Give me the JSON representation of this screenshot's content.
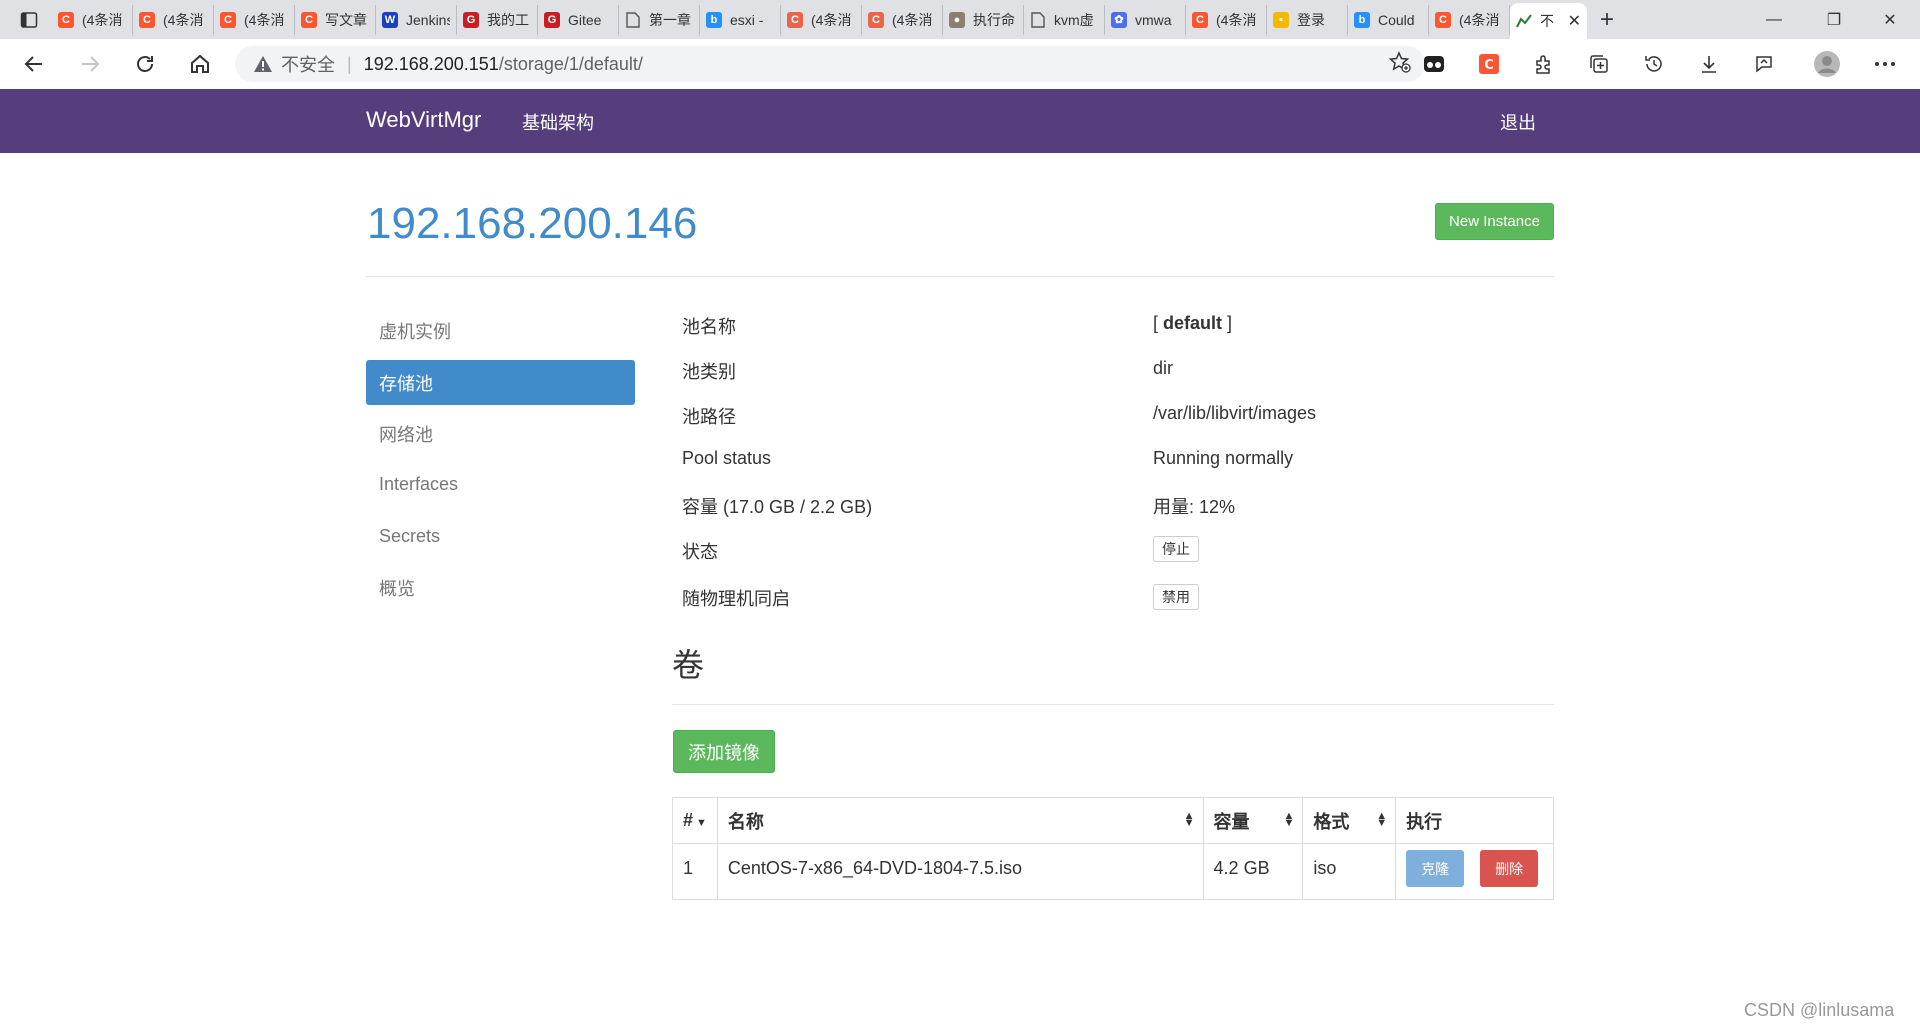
{
  "browser": {
    "tabs": [
      {
        "label": "(4条消",
        "icon": "csdn-icon",
        "color": "#fc5531"
      },
      {
        "label": "(4条消",
        "icon": "csdn-icon",
        "color": "#fc5531"
      },
      {
        "label": "(4条消",
        "icon": "csdn-icon",
        "color": "#fc5531"
      },
      {
        "label": "写文章",
        "icon": "csdn-icon",
        "color": "#fc5531"
      },
      {
        "label": "Jenkins",
        "icon": "w-icon",
        "color": "#1a3fc2"
      },
      {
        "label": "我的工",
        "icon": "gitee-icon",
        "color": "#c71d23"
      },
      {
        "label": "Gitee",
        "icon": "gitee-icon",
        "color": "#c71d23"
      },
      {
        "label": "第一章",
        "icon": "doc-icon",
        "color": "#555555"
      },
      {
        "label": "esxi -",
        "icon": "bing-icon",
        "color": "#258ffa"
      },
      {
        "label": "(4条消",
        "icon": "csdn-icon",
        "color": "#e8644a"
      },
      {
        "label": "(4条消",
        "icon": "csdn-icon",
        "color": "#e8644a"
      },
      {
        "label": "执行命",
        "icon": "avatar-icon",
        "color": "#8a7f70"
      },
      {
        "label": "kvm虚",
        "icon": "doc-icon",
        "color": "#555555"
      },
      {
        "label": "vmwa",
        "icon": "paw-icon",
        "color": "#4e6ef2"
      },
      {
        "label": "(4条消",
        "icon": "csdn-icon",
        "color": "#fc5531"
      },
      {
        "label": "登录",
        "icon": "tile-icon",
        "color": "#f5b800"
      },
      {
        "label": "Could",
        "icon": "bing-icon",
        "color": "#258ffa"
      },
      {
        "label": "(4条消",
        "icon": "csdn-icon",
        "color": "#fc5531"
      }
    ],
    "active_tab": {
      "label": "不",
      "icon": "chart-icon"
    },
    "url_security": "不安全",
    "url_host": "192.168.200.151",
    "url_path": "/storage/1/default/"
  },
  "app": {
    "brand": "WebVirtMgr",
    "nav_link": "基础架构",
    "logout": "退出"
  },
  "page": {
    "host": "192.168.200.146",
    "new_instance": "New Instance",
    "sidebar": [
      {
        "label": "虚机实例",
        "active": false
      },
      {
        "label": "存储池",
        "active": true
      },
      {
        "label": "网络池",
        "active": false
      },
      {
        "label": "Interfaces",
        "active": false
      },
      {
        "label": "Secrets",
        "active": false
      },
      {
        "label": "概览",
        "active": false
      }
    ],
    "pool": {
      "name_label": "池名称",
      "name_open": "[ ",
      "name_value": "default",
      "name_close": " ]",
      "type_label": "池类别",
      "type_value": "dir",
      "path_label": "池路径",
      "path_value": "/var/lib/libvirt/images",
      "status_label": "Pool status",
      "status_value": "Running normally",
      "capacity_label": "容量 (17.0 GB / 2.2 GB)",
      "usage_value": "用量: 12%",
      "state_label": "状态",
      "state_button": "停止",
      "autostart_label": "随物理机同启",
      "autostart_button": "禁用"
    },
    "volumes_title": "卷",
    "add_image": "添加镜像",
    "table": {
      "headers": [
        "#",
        "名称",
        "容量",
        "格式",
        "执行"
      ],
      "rows": [
        {
          "num": "1",
          "name": "CentOS-7-x86_64-DVD-1804-7.5.iso",
          "size": "4.2 GB",
          "format": "iso",
          "clone": "克隆",
          "delete": "删除"
        }
      ]
    }
  },
  "watermark": "CSDN @linlusama"
}
